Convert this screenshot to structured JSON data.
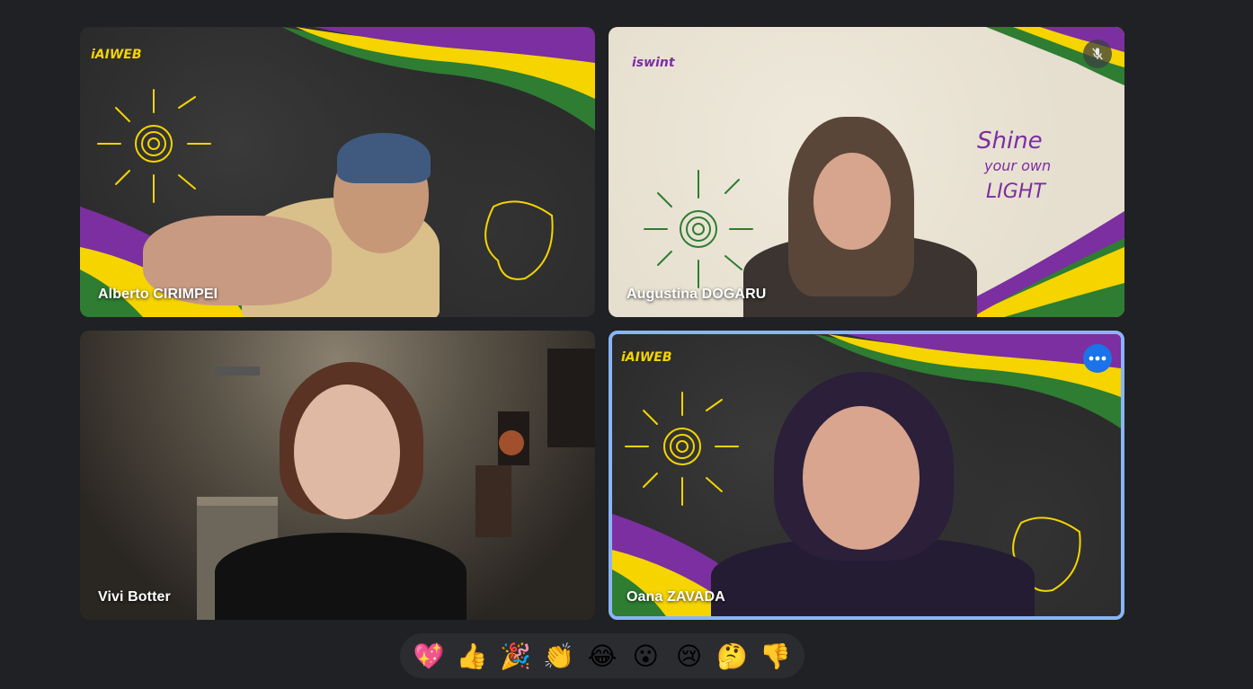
{
  "participants": [
    {
      "name": "Alberto CIRIMPEI"
    },
    {
      "name": "Augustina DOGARU"
    },
    {
      "name": "Vivi Botter"
    },
    {
      "name": "Oana ZAVADA"
    }
  ],
  "background_art": {
    "logo_text": "iAIWEB",
    "logo_text_purple": "iswint",
    "slogan_line1": "Shine",
    "slogan_line2": "your own",
    "slogan_line3": "LIGHT",
    "stripe_colors": [
      "#7b2fa0",
      "#f5d400",
      "#2e7d32"
    ]
  },
  "reactions": [
    {
      "emoji": "💖",
      "name": "sparkling-heart"
    },
    {
      "emoji": "👍",
      "name": "thumbs-up"
    },
    {
      "emoji": "🎉",
      "name": "party-popper"
    },
    {
      "emoji": "👏",
      "name": "clapping"
    },
    {
      "emoji": "😂",
      "name": "tears-of-joy"
    },
    {
      "emoji": "😮",
      "name": "surprised"
    },
    {
      "emoji": "😢",
      "name": "crying"
    },
    {
      "emoji": "🤔",
      "name": "thinking"
    },
    {
      "emoji": "👎",
      "name": "thumbs-down"
    }
  ],
  "colors": {
    "background": "#202124",
    "speaking_border": "#8ab4f8",
    "more_button": "#1a73e8",
    "reaction_bar": "#2b2c30"
  }
}
